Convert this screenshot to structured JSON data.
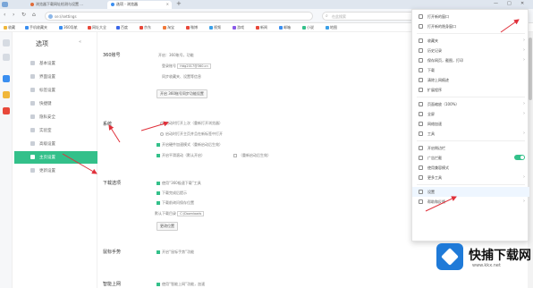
{
  "window": {
    "tabs": [
      {
        "label": "浏览器下载网址检测与设置 ...",
        "active": false
      },
      {
        "label": "选项 - 浏览器",
        "active": true
      }
    ],
    "new_tab": "+",
    "controls": [
      "—",
      "□",
      "✕"
    ]
  },
  "toolbar": {
    "url": "se://settings",
    "search_placeholder": "在此搜索",
    "icons": [
      "back-icon",
      "forward-icon",
      "refresh-icon",
      "home-icon",
      "star-icon",
      "download-icon",
      "extension-icon",
      "menu-icon"
    ]
  },
  "bookmarks": [
    {
      "label": "收藏",
      "color": "#f0b73a"
    },
    {
      "label": "手机收藏夹",
      "color": "#3a8ef0"
    },
    {
      "label": "360导航",
      "color": "#3a8ef0"
    },
    {
      "label": "网址大全",
      "color": "#e8483a"
    },
    {
      "label": "百度",
      "color": "#3a66e8"
    },
    {
      "label": "京东",
      "color": "#e8483a"
    },
    {
      "label": "淘宝",
      "color": "#f07a3a"
    },
    {
      "label": "微博",
      "color": "#e8483a"
    },
    {
      "label": "视频",
      "color": "#3aa0e8"
    },
    {
      "label": "游戏",
      "color": "#8a5ae8"
    },
    {
      "label": "新闻",
      "color": "#e8483a"
    },
    {
      "label": "邮箱",
      "color": "#3a8ef0"
    },
    {
      "label": "小说",
      "color": "#33c08a"
    },
    {
      "label": "地图",
      "color": "#3aa0e8"
    }
  ],
  "sidebar": {
    "title": "选项",
    "collapse": "«",
    "items": [
      {
        "label": "基本设置",
        "active": false
      },
      {
        "label": "界面设置",
        "active": false
      },
      {
        "label": "标签设置",
        "active": false
      },
      {
        "label": "快捷键",
        "active": false
      },
      {
        "label": "隐私安全",
        "active": false
      },
      {
        "label": "实验室",
        "active": false
      },
      {
        "label": "高级设置",
        "active": false
      },
      {
        "label": "主页设置",
        "active": true
      },
      {
        "label": "更新设置",
        "active": false
      }
    ]
  },
  "main": {
    "sections": [
      {
        "title": "360账号",
        "rows": [
          {
            "type": "text",
            "text": "开启：360账号，功能"
          },
          {
            "type": "field",
            "label": "登录账号",
            "value": "Hdg2017@360.cn"
          },
          {
            "type": "text",
            "text": "同步收藏夹、设置等信息"
          },
          {
            "type": "button",
            "text": "开启 360账号同步功能设置"
          }
        ]
      },
      {
        "title": "系统",
        "rows": [
          {
            "type": "radio",
            "text": "启动时打开上次（重新打开浏览器）"
          },
          {
            "type": "radio",
            "text": "启动时打开主页并且在新标签中打开"
          },
          {
            "type": "checkbox",
            "checked": true,
            "text": "开启硬件加速模式（重新启动后生效）"
          },
          {
            "type": "checkbox",
            "checked": true,
            "text": "开启平滑滚动（默认开启）"
          },
          {
            "type": "checkbox",
            "checked": false,
            "text": "（重新启动后生效）"
          }
        ]
      },
      {
        "title": "下载选项",
        "rows": [
          {
            "type": "checkbox",
            "checked": true,
            "text": "使用“360极速下载”工具"
          },
          {
            "type": "checkbox",
            "checked": true,
            "text": "下载完成后提示"
          },
          {
            "type": "checkbox",
            "checked": true,
            "text": "下载前询问保存位置"
          },
          {
            "type": "select",
            "label": "默认下载目录",
            "value": "C:\\Downloads"
          },
          {
            "type": "button",
            "text": "更改位置"
          }
        ]
      },
      {
        "title": "鼠标手势",
        "rows": [
          {
            "type": "checkbox",
            "checked": true,
            "text": "开启“鼠标手势”功能"
          }
        ]
      },
      {
        "title": "智能上网",
        "rows": [
          {
            "type": "checkbox",
            "checked": true,
            "text": "使用“智能上网”功能，加速"
          }
        ]
      }
    ]
  },
  "menu": {
    "items": [
      {
        "label": "打开新的窗口",
        "has_arrow": false,
        "toggle": false,
        "highlight": false
      },
      {
        "label": "打开新的隐身窗口",
        "has_arrow": false,
        "toggle": false,
        "highlight": false
      },
      {
        "label": "收藏夹",
        "has_arrow": true,
        "toggle": false,
        "highlight": false
      },
      {
        "label": "历史记录",
        "has_arrow": true,
        "toggle": false,
        "highlight": false
      },
      {
        "label": "保存网页，截图，打印",
        "has_arrow": true,
        "toggle": false,
        "highlight": false
      },
      {
        "label": "下载",
        "has_arrow": false,
        "toggle": false,
        "highlight": false
      },
      {
        "label": "清除上网痕迹",
        "has_arrow": false,
        "toggle": false,
        "highlight": false
      },
      {
        "label": "扩展程序",
        "has_arrow": false,
        "toggle": false,
        "highlight": false
      },
      {
        "label": "页面缩放（100%）",
        "has_arrow": true,
        "toggle": false,
        "highlight": false
      },
      {
        "label": "全屏",
        "has_arrow": true,
        "toggle": false,
        "highlight": false
      },
      {
        "label": "网络加速",
        "has_arrow": false,
        "toggle": false,
        "highlight": false
      },
      {
        "label": "工具",
        "has_arrow": true,
        "toggle": false,
        "highlight": false
      },
      {
        "label": "开启侧边栏",
        "has_arrow": false,
        "toggle": false,
        "highlight": false
      },
      {
        "label": "广告拦截",
        "has_arrow": false,
        "toggle": true,
        "highlight": false
      },
      {
        "label": "使用兼容模式",
        "has_arrow": false,
        "toggle": false,
        "highlight": false
      },
      {
        "label": "更多工具",
        "has_arrow": true,
        "toggle": false,
        "highlight": false
      },
      {
        "label": "设置",
        "has_arrow": false,
        "toggle": false,
        "highlight": true
      },
      {
        "label": "帮助和反馈",
        "has_arrow": true,
        "toggle": false,
        "highlight": false
      }
    ]
  },
  "watermark": {
    "title": "快捕下载网",
    "url": "www.kkx.net"
  },
  "colors": {
    "accent": "#33c08a",
    "annotation": "#e0303a",
    "menu_highlight": "#eef6ff"
  }
}
